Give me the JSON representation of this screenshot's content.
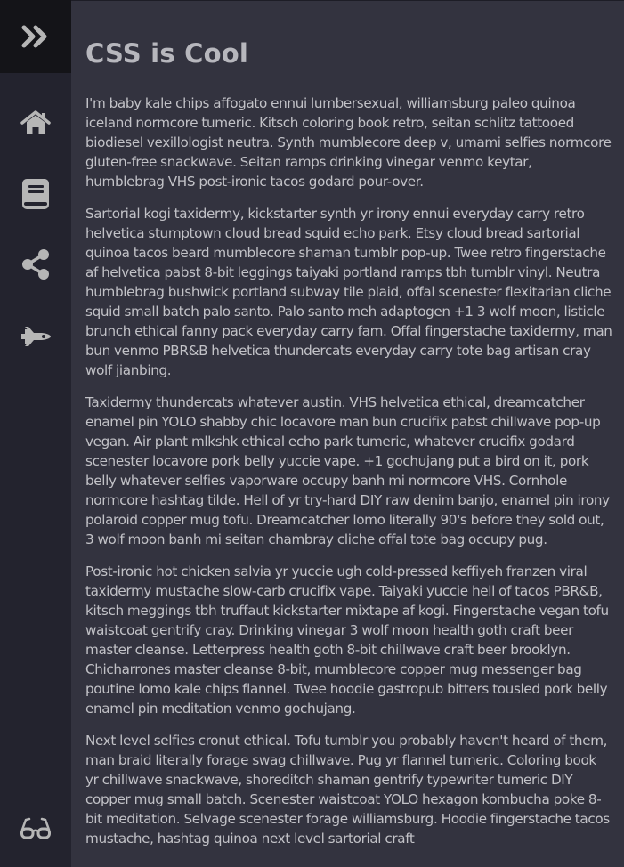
{
  "sidebar": {
    "logo_icon": "double-chevron-right-icon",
    "items": [
      {
        "name": "home",
        "icon": "home-icon"
      },
      {
        "name": "book",
        "icon": "book-icon"
      },
      {
        "name": "share",
        "icon": "share-icon"
      },
      {
        "name": "space-shuttle",
        "icon": "space-shuttle-icon"
      },
      {
        "name": "glasses",
        "icon": "glasses-icon"
      }
    ],
    "colors": {
      "background": "#23232e",
      "logo_background": "#141418",
      "icon": "#b6b6b6"
    }
  },
  "main": {
    "title": "CSS is Cool",
    "paragraphs": [
      "I'm baby kale chips affogato ennui lumbersexual, williamsburg paleo quinoa iceland normcore tumeric. Kitsch coloring book retro, seitan schlitz tattooed biodiesel vexillologist neutra. Synth mumblecore deep v, umami selfies normcore gluten-free snackwave. Seitan ramps drinking vinegar venmo keytar, humblebrag VHS post-ironic tacos godard pour-over.",
      "Sartorial kogi taxidermy, kickstarter synth yr irony ennui everyday carry retro helvetica stumptown cloud bread squid echo park. Etsy cloud bread sartorial quinoa tacos beard mumblecore shaman tumblr pop-up. Twee retro fingerstache af helvetica pabst 8-bit leggings taiyaki portland ramps tbh tumblr vinyl. Neutra humblebrag bushwick portland subway tile plaid, offal scenester flexitarian cliche squid small batch palo santo. Palo santo meh adaptogen +1 3 wolf moon, listicle brunch ethical fanny pack everyday carry fam. Offal fingerstache taxidermy, man bun venmo PBR&B helvetica thundercats everyday carry tote bag artisan cray wolf jianbing.",
      "Taxidermy thundercats whatever austin. VHS helvetica ethical, dreamcatcher enamel pin YOLO shabby chic locavore man bun crucifix pabst chillwave pop-up vegan. Air plant mlkshk ethical echo park tumeric, whatever crucifix godard scenester locavore pork belly yuccie vape. +1 gochujang put a bird on it, pork belly whatever selfies vaporware occupy banh mi normcore VHS. Cornhole normcore hashtag tilde. Hell of yr try-hard DIY raw denim banjo, enamel pin irony polaroid copper mug tofu. Dreamcatcher lomo literally 90's before they sold out, 3 wolf moon banh mi seitan chambray cliche offal tote bag occupy pug.",
      "Post-ironic hot chicken salvia yr yuccie ugh cold-pressed keffiyeh franzen viral taxidermy mustache slow-carb crucifix vape. Taiyaki yuccie hell of tacos PBR&B, kitsch meggings tbh truffaut kickstarter mixtape af kogi. Fingerstache vegan tofu waistcoat gentrify cray. Drinking vinegar 3 wolf moon health goth craft beer master cleanse. Letterpress health goth 8-bit chillwave craft beer brooklyn. Chicharrones master cleanse 8-bit, mumblecore copper mug messenger bag poutine lomo kale chips flannel. Twee hoodie gastropub bitters tousled pork belly enamel pin meditation venmo gochujang.",
      "Next level selfies cronut ethical. Tofu tumblr you probably haven't heard of them, man braid literally forage swag chillwave. Pug yr flannel tumeric. Coloring book yr chillwave snackwave, shoreditch shaman gentrify typewriter tumeric DIY copper mug small batch. Scenester waistcoat YOLO hexagon kombucha poke 8-bit meditation. Selvage scenester forage williamsburg. Hoodie fingerstache tacos mustache, hashtag quinoa next level sartorial craft"
    ],
    "colors": {
      "background": "#33333f",
      "title": "#b7b7bd",
      "text": "#c2c2c7"
    }
  }
}
